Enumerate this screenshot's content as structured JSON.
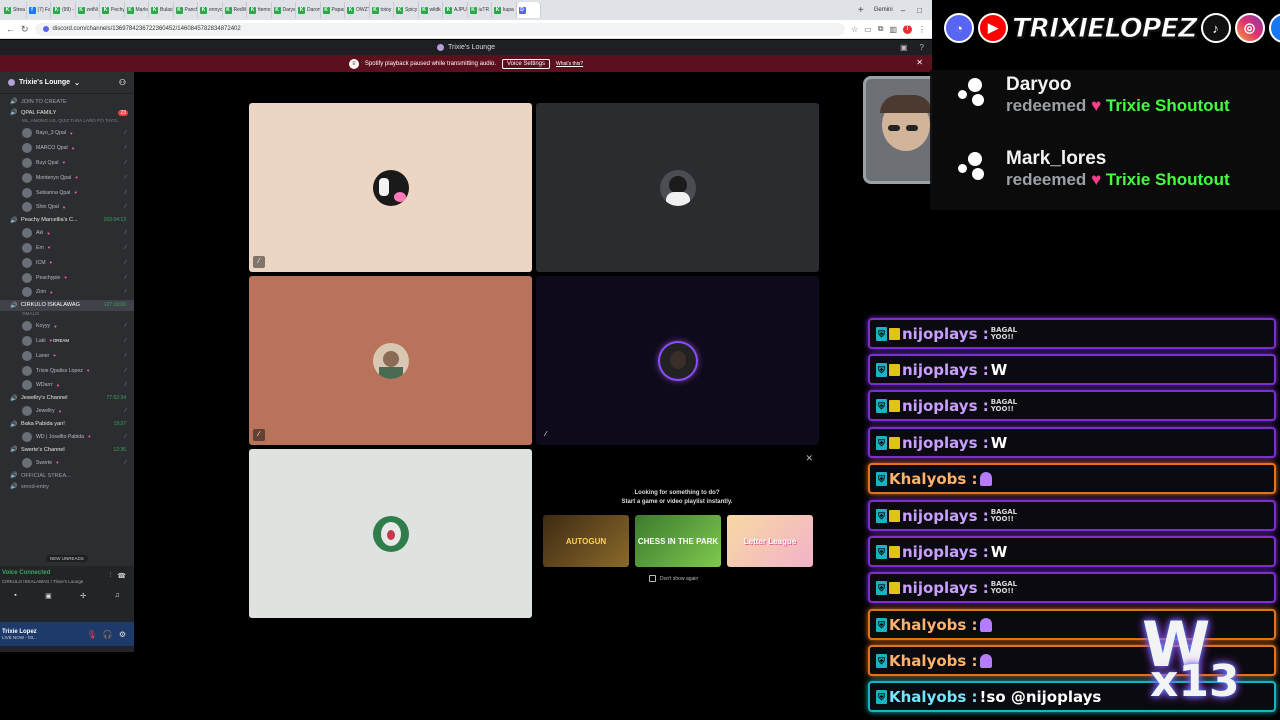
{
  "browser": {
    "tabs": [
      {
        "label": "Strea",
        "icon": "K"
      },
      {
        "label": "(7) Fa",
        "icon": "f"
      },
      {
        "label": "(99) -",
        "icon": "K"
      },
      {
        "label": "zetNi",
        "icon": "K"
      },
      {
        "label": "Pechy",
        "icon": "K"
      },
      {
        "label": "Marlo",
        "icon": "K"
      },
      {
        "label": "Bulaci",
        "icon": "K"
      },
      {
        "label": "Panch",
        "icon": "K"
      },
      {
        "label": "ennyo",
        "icon": "K"
      },
      {
        "label": "RedWi",
        "icon": "K"
      },
      {
        "label": "ttemo",
        "icon": "K"
      },
      {
        "label": "Darys",
        "icon": "K"
      },
      {
        "label": "Daron",
        "icon": "K"
      },
      {
        "label": "Papas",
        "icon": "K"
      },
      {
        "label": "OWZT",
        "icon": "K"
      },
      {
        "label": "totoy",
        "icon": "K"
      },
      {
        "label": "Spicy",
        "icon": "K"
      },
      {
        "label": "wildk",
        "icon": "K"
      },
      {
        "label": "AJPU",
        "icon": "K"
      },
      {
        "label": "iuTR",
        "icon": "K"
      },
      {
        "label": "kupa",
        "icon": "K"
      },
      {
        "label": "",
        "icon": "D"
      }
    ],
    "right_tab": "Gemini",
    "url": "discord.com/channels/1369784236722360452/1460845782834872402"
  },
  "discord": {
    "title": "Trixie's Lounge",
    "banner": {
      "text": "Spotify playback paused while transmitting audio.",
      "button": "Voice Settings",
      "link": "What's this?"
    },
    "server_name": "Trixie's Lounge",
    "channels": [
      {
        "type": "channel",
        "name": "JOIN TO CREATE"
      },
      {
        "type": "channel",
        "name": "QPAL FAMILY",
        "badge": "23",
        "badge_type": "red",
        "sub": "ML, AMONG US, QUIZ TARA LARO PO TAYO..."
      },
      {
        "type": "user",
        "name": "Bayo_3 Qpal"
      },
      {
        "type": "user",
        "name": "MARCO Qpal"
      },
      {
        "type": "user",
        "name": "Buyi Qpal"
      },
      {
        "type": "user",
        "name": "Montenyo Qpal"
      },
      {
        "type": "user",
        "name": "Sebianna Qpal"
      },
      {
        "type": "user",
        "name": "Shin Qpal"
      },
      {
        "type": "channel",
        "name": "Peachy Marcellia's C...",
        "badge": "203:04:13",
        "badge_type": "time"
      },
      {
        "type": "user",
        "name": "Aki"
      },
      {
        "type": "user",
        "name": "Em"
      },
      {
        "type": "user",
        "name": "ICM"
      },
      {
        "type": "user",
        "name": "Peachypie"
      },
      {
        "type": "user",
        "name": "Zirin"
      },
      {
        "type": "channel",
        "name": "CIRKULO ISKALAWAG",
        "badge": "127:19:00",
        "badge_type": "time",
        "selected": true,
        "sub": "OMALIS"
      },
      {
        "type": "user",
        "name": "Koyyy"
      },
      {
        "type": "user",
        "name": "Laki",
        "tag": "DREAM"
      },
      {
        "type": "user",
        "name": "Laner"
      },
      {
        "type": "user",
        "name": "Trixie Qpaliss Lopez"
      },
      {
        "type": "user",
        "name": "WDarrr"
      },
      {
        "type": "channel",
        "name": "Jewellry's Channel",
        "badge": "77:52:34",
        "badge_type": "time"
      },
      {
        "type": "user",
        "name": "Jewellry"
      },
      {
        "type": "channel",
        "name": "Baka Pabida yan!",
        "badge": "19:37",
        "badge_type": "time"
      },
      {
        "type": "user",
        "name": "WD | Josellto Pabida"
      },
      {
        "type": "channel",
        "name": "Swerte's Channel",
        "badge": "12:36",
        "badge_type": "time"
      },
      {
        "type": "user",
        "name": "Swerte"
      },
      {
        "type": "channel",
        "name": "OFFICIAL STREA..."
      },
      {
        "type": "channel",
        "name": "smod-entry"
      }
    ],
    "new_unreads": "NEW UNREADS",
    "voice": {
      "status": "Voice Connected",
      "sub": "CIRKULO ISKALAWAG / Trixie's Lounge"
    },
    "user": {
      "name": "Trixie Lopez",
      "status": "LIVE NOW - htt..."
    },
    "activity": {
      "line1": "Looking for something to do?",
      "line2": "Start a game or video playlist instantly.",
      "games": [
        "AUTOGUN",
        "CHESS IN THE PARK",
        "Letter League"
      ],
      "dont_show": "Don't show again"
    }
  },
  "overlay": {
    "brand": "TRIXIELOPEZ",
    "redemptions": [
      {
        "user": "Daryoo",
        "verb": "redeemed",
        "reward": "Trixie Shoutout"
      },
      {
        "user": "Mark_lores",
        "verb": "redeemed",
        "reward": "Trixie Shoutout"
      }
    ],
    "chat": [
      {
        "user": "nijoplays :",
        "msg": "BAGAL YOO!!",
        "emote": true,
        "color": "purple"
      },
      {
        "user": "nijoplays :",
        "msg": "W",
        "emote": false,
        "color": "purple"
      },
      {
        "user": "nijoplays :",
        "msg": "BAGAL YOO!!",
        "emote": true,
        "color": "purple"
      },
      {
        "user": "nijoplays :",
        "msg": "W",
        "emote": false,
        "color": "purple"
      },
      {
        "user": "Khalyobs :",
        "msg": "",
        "emote": false,
        "heart": true,
        "color": "orange"
      },
      {
        "user": "nijoplays :",
        "msg": "BAGAL YOO!!",
        "emote": true,
        "color": "purple"
      },
      {
        "user": "nijoplays :",
        "msg": "W",
        "emote": false,
        "color": "purple"
      },
      {
        "user": "nijoplays :",
        "msg": "BAGAL YOO!!",
        "emote": true,
        "color": "purple"
      },
      {
        "user": "Khalyobs :",
        "msg": "",
        "emote": false,
        "heart": true,
        "color": "orange"
      },
      {
        "user": "Khalyobs :",
        "msg": "",
        "emote": false,
        "heart": true,
        "color": "orange"
      },
      {
        "user": "Khalyobs :",
        "msg": "!so @nijoplays",
        "emote": false,
        "color": "cyan"
      }
    ],
    "w_badge": {
      "w": "W",
      "count": "x13"
    }
  }
}
